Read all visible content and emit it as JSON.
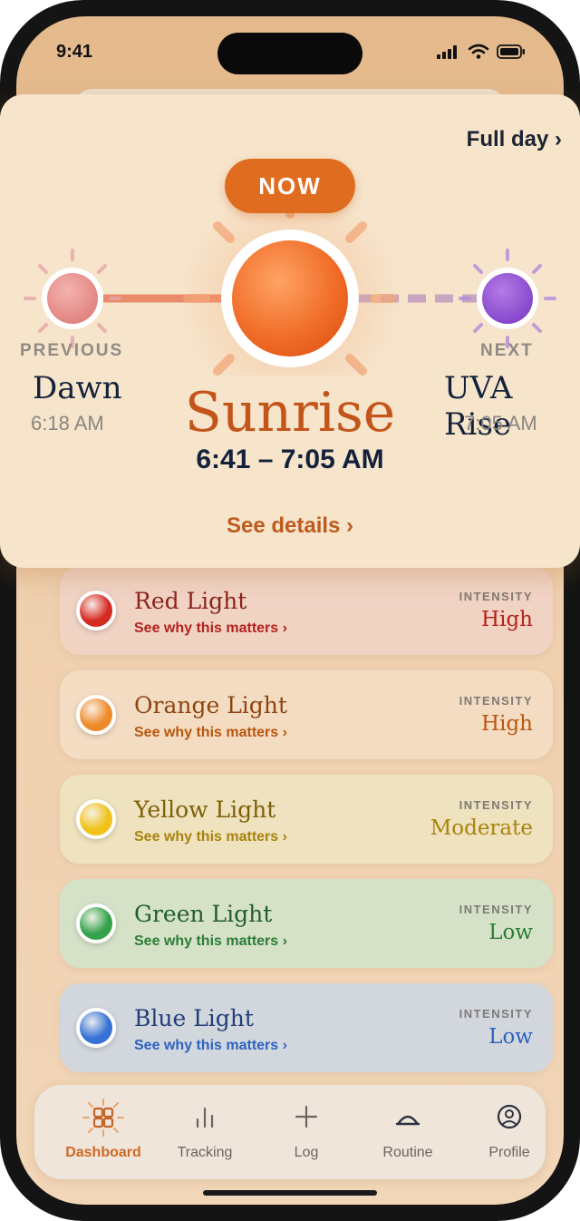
{
  "status": {
    "time": "9:41"
  },
  "hero": {
    "full_day_label": "Full day ›",
    "now_label": "NOW",
    "previous": {
      "label": "PREVIOUS",
      "name": "Dawn",
      "time": "6:18 AM"
    },
    "current": {
      "name": "Sunrise",
      "time": "6:41 – 7:05 AM"
    },
    "next": {
      "label": "NEXT",
      "name": "UVA Rise",
      "time": "7:05 AM"
    },
    "see_details": "See details  ›"
  },
  "lights": [
    {
      "name": "Red Light",
      "why": "See why this matters ›",
      "intensity_label": "INTENSITY",
      "intensity": "High",
      "color": "#d42a22",
      "bg": "#f1d3c4",
      "text": "#b3221c",
      "name_color": "#8a241c"
    },
    {
      "name": "Orange Light",
      "why": "See why this matters ›",
      "intensity_label": "INTENSITY",
      "intensity": "High",
      "color": "#ee8a2a",
      "bg": "#f4dcc3",
      "text": "#b8560f",
      "name_color": "#8d4510"
    },
    {
      "name": "Yellow Light",
      "why": "See why this matters ›",
      "intensity_label": "INTENSITY",
      "intensity": "Moderate",
      "color": "#f0c21a",
      "bg": "#efe2bf",
      "text": "#a8830d",
      "name_color": "#7d5f07"
    },
    {
      "name": "Green Light",
      "why": "See why this matters ›",
      "intensity_label": "INTENSITY",
      "intensity": "Low",
      "color": "#34a24a",
      "bg": "#d6e2c8",
      "text": "#2b7d35",
      "name_color": "#225e2a"
    },
    {
      "name": "Blue Light",
      "why": "See why this matters ›",
      "intensity_label": "INTENSITY",
      "intensity": "Low",
      "color": "#3672d4",
      "bg": "#d2d7de",
      "text": "#2c62c0",
      "name_color": "#223e78"
    }
  ],
  "tabs": [
    {
      "label": "Dashboard",
      "icon": "dashboard-icon",
      "active": true
    },
    {
      "label": "Tracking",
      "icon": "chart-bars-icon",
      "active": false
    },
    {
      "label": "Log",
      "icon": "plus-icon",
      "active": false
    },
    {
      "label": "Routine",
      "icon": "sunrise-arc-icon",
      "active": false
    },
    {
      "label": "Profile",
      "icon": "user-circle-icon",
      "active": false
    }
  ]
}
